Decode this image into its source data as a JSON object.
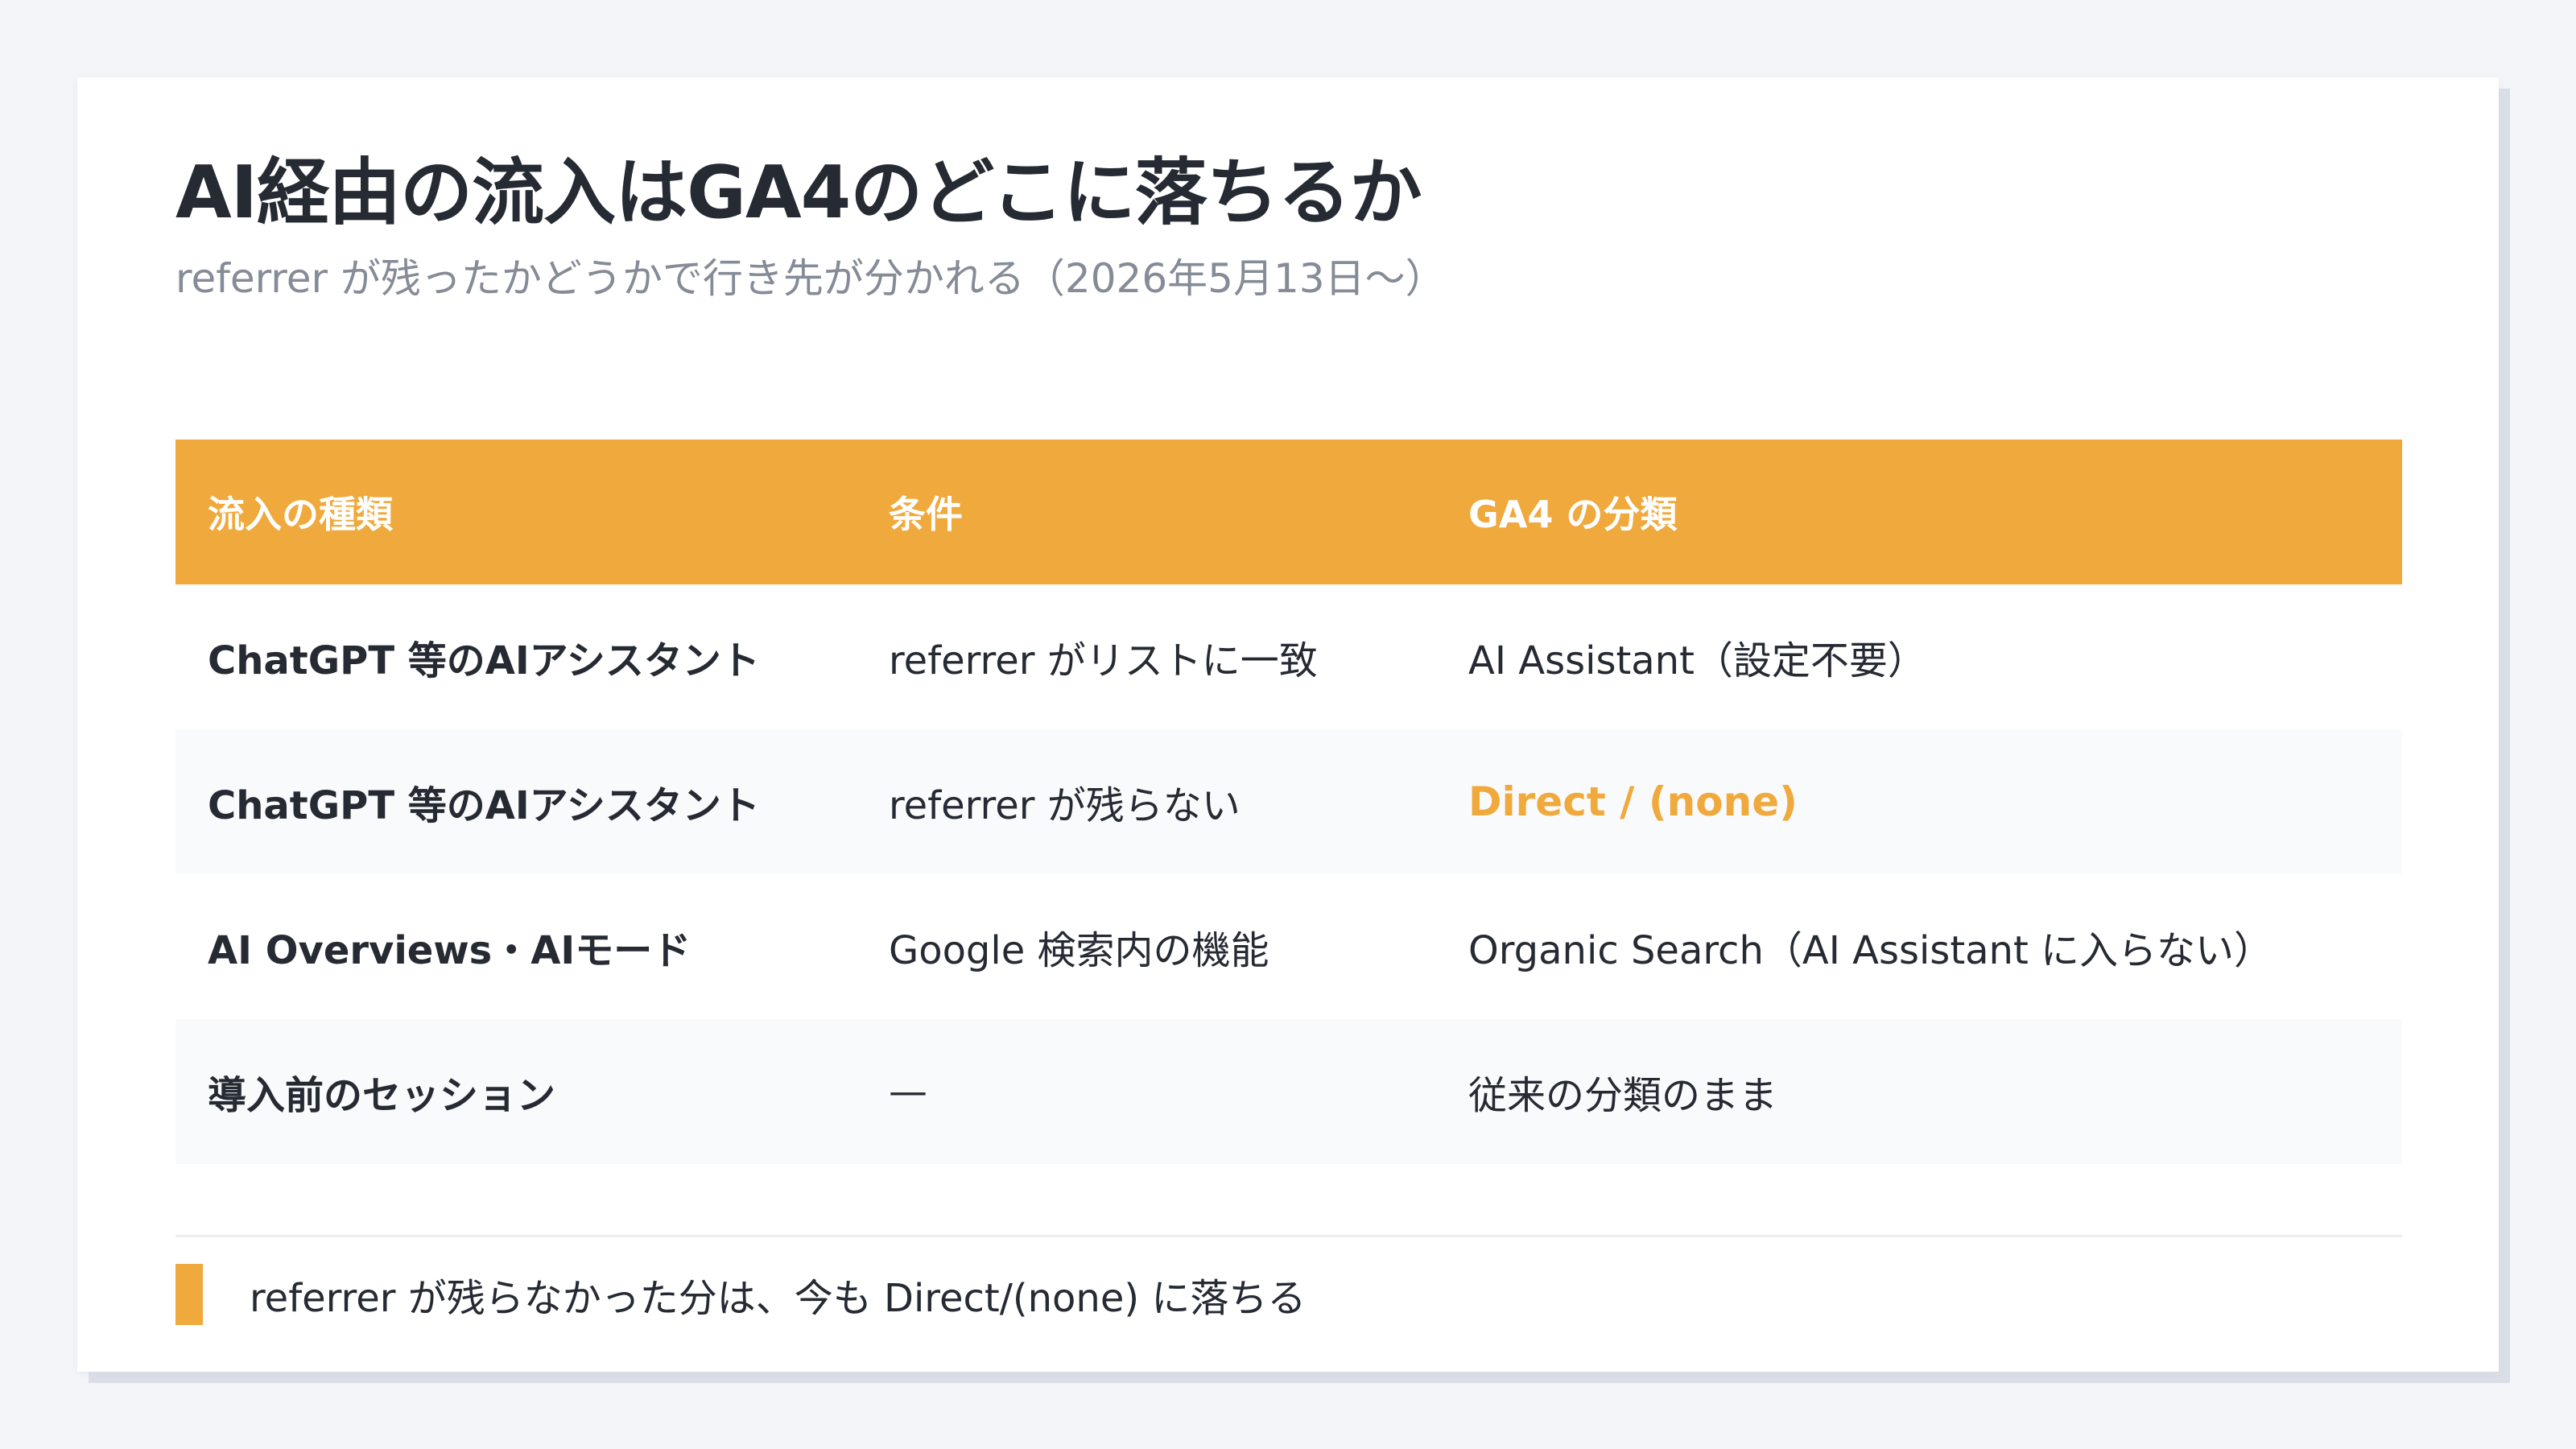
{
  "title": "AI経由の流入はGA4のどこに落ちるか",
  "subtitle": "referrer が残ったかどうかで行き先が分かれる（2026年5月13日〜）",
  "colors": {
    "accent": "#f0a93c",
    "text": "#262a33",
    "muted": "#858b97",
    "background": "#f4f5f9",
    "row_alt": "#f9fafc"
  },
  "table": {
    "headers": [
      "流入の種類",
      "条件",
      "GA4 の分類"
    ],
    "rows": [
      {
        "type": "ChatGPT 等のAIアシスタント",
        "condition": "referrer がリストに一致",
        "classification": "AI Assistant（設定不要）"
      },
      {
        "type": "ChatGPT 等のAIアシスタント",
        "condition": "referrer が残らない",
        "classification": "Direct / (none)"
      },
      {
        "type": "AI Overviews・AIモード",
        "condition": "Google 検索内の機能",
        "classification": "Organic Search（AI Assistant に入らない）"
      },
      {
        "type": "導入前のセッション",
        "condition": "—",
        "classification": "従来の分類のまま"
      }
    ]
  },
  "note": "referrer が残らなかった分は、今も Direct/(none) に落ちる"
}
